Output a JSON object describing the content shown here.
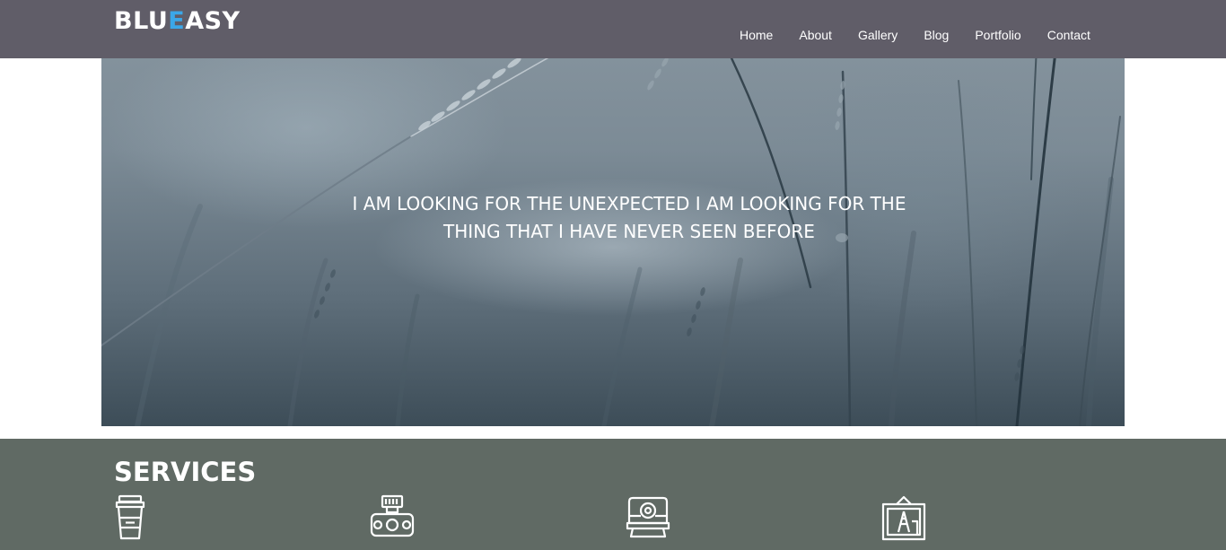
{
  "header": {
    "logo_part1": "BLU",
    "logo_accent": "E",
    "logo_part2": "ASY",
    "accent_color": "#3ba7e8",
    "nav": [
      "Home",
      "About",
      "Gallery",
      "Blog",
      "Portfolio",
      "Contact"
    ]
  },
  "hero": {
    "line1": "I AM LOOKING FOR THE UNEXPECTED I AM LOOKING FOR THE",
    "line2": "THING THAT I HAVE NEVER SEEN BEFORE"
  },
  "services": {
    "title": "SERVICES",
    "icons": [
      "coffee-cup-icon",
      "retro-camera-icon",
      "instant-camera-icon",
      "framed-picture-icon"
    ]
  }
}
